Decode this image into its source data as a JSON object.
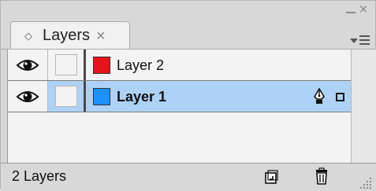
{
  "panel": {
    "tab_label": "Layers",
    "tab_collapse_icon": "◇",
    "tab_close_icon": "×",
    "close_icon": "×",
    "minimize_icon": "minimize-icon",
    "menu_icon": "panel-menu-icon"
  },
  "layers": [
    {
      "name": "Layer 2",
      "color": "#e8141b",
      "visible": true,
      "locked": false,
      "selected": false
    },
    {
      "name": "Layer 1",
      "color": "#1e90ff",
      "visible": true,
      "locked": false,
      "selected": true
    }
  ],
  "footer": {
    "count_text": "2 Layers",
    "new_layer_icon": "new-layer-icon",
    "trash_icon": "trash-icon"
  },
  "colors": {
    "selection": "#aed2f6",
    "panel_bg": "#d8d8d8"
  }
}
